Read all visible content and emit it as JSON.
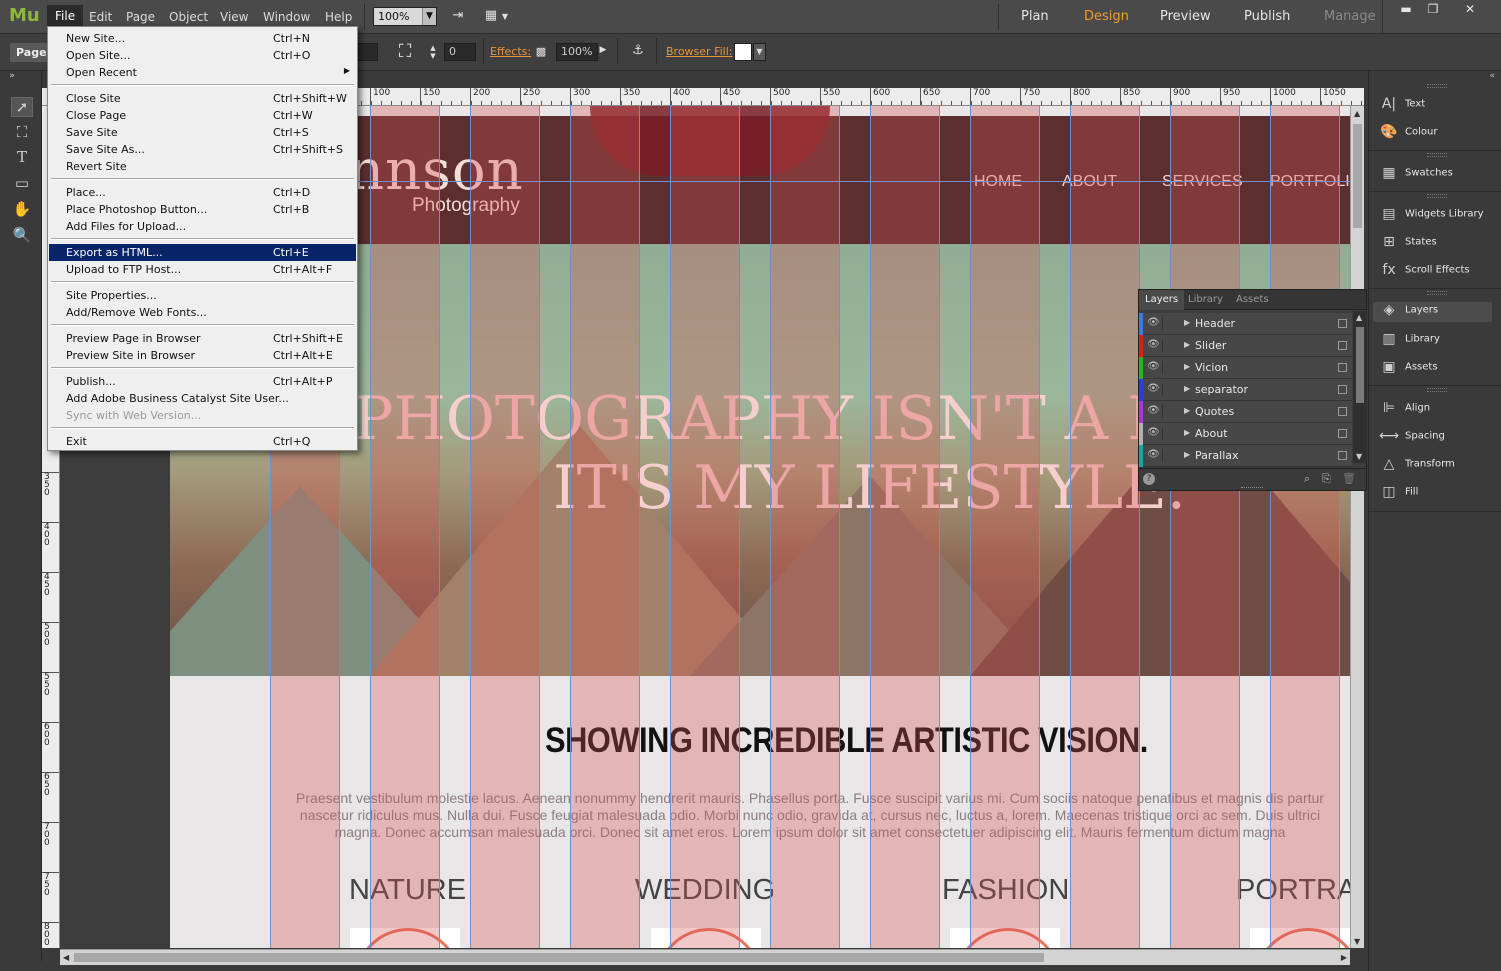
{
  "app": {
    "logo": "Mu"
  },
  "menubar": {
    "items": [
      "File",
      "Edit",
      "Page",
      "Object",
      "View",
      "Window",
      "Help"
    ]
  },
  "toolbar": {
    "zoom_value": "100%"
  },
  "modes": {
    "plan": "Plan",
    "design": "Design",
    "preview": "Preview",
    "publish": "Publish",
    "manage": "Manage"
  },
  "control": {
    "page_label": "Page",
    "rotate_value": "0",
    "effects_label": "Effects:",
    "opacity_value": "100%",
    "browser_fill_label": "Browser Fill:",
    "browser_fill_color": "#ffffff"
  },
  "ruler": {
    "h_labels": [
      "100",
      "150",
      "200",
      "250",
      "300",
      "350",
      "400",
      "450",
      "500",
      "550",
      "600",
      "650",
      "700",
      "750",
      "800",
      "850",
      "900",
      "950",
      "1000",
      "1050"
    ],
    "v_labels": [
      "350",
      "400",
      "450",
      "500",
      "550",
      "600",
      "650",
      "700",
      "750",
      "800"
    ]
  },
  "file_menu": {
    "groups": [
      [
        {
          "label": "New Site...",
          "shortcut": "Ctrl+N"
        },
        {
          "label": "Open Site...",
          "shortcut": "Ctrl+O"
        },
        {
          "label": "Open Recent",
          "shortcut": "",
          "submenu": true
        }
      ],
      [
        {
          "label": "Close Site",
          "shortcut": "Ctrl+Shift+W"
        },
        {
          "label": "Close Page",
          "shortcut": "Ctrl+W"
        },
        {
          "label": "Save Site",
          "shortcut": "Ctrl+S"
        },
        {
          "label": "Save Site As...",
          "shortcut": "Ctrl+Shift+S"
        },
        {
          "label": "Revert Site",
          "shortcut": ""
        }
      ],
      [
        {
          "label": "Place...",
          "shortcut": "Ctrl+D"
        },
        {
          "label": "Place Photoshop Button...",
          "shortcut": "Ctrl+B"
        },
        {
          "label": "Add Files for Upload...",
          "shortcut": ""
        }
      ],
      [
        {
          "label": "Export as HTML...",
          "shortcut": "Ctrl+E",
          "highlighted": true
        },
        {
          "label": "Upload to FTP Host...",
          "shortcut": "Ctrl+Alt+F"
        }
      ],
      [
        {
          "label": "Site Properties...",
          "shortcut": ""
        },
        {
          "label": "Add/Remove Web Fonts...",
          "shortcut": ""
        }
      ],
      [
        {
          "label": "Preview Page in Browser",
          "shortcut": "Ctrl+Shift+E"
        },
        {
          "label": "Preview Site in Browser",
          "shortcut": "Ctrl+Alt+E"
        }
      ],
      [
        {
          "label": "Publish...",
          "shortcut": "Ctrl+Alt+P"
        },
        {
          "label": "Add Adobe Business Catalyst Site User...",
          "shortcut": ""
        },
        {
          "label": "Sync with Web Version...",
          "shortcut": "",
          "disabled": true
        }
      ],
      [
        {
          "label": "Exit",
          "shortcut": "Ctrl+Q"
        }
      ]
    ]
  },
  "site": {
    "brand_main": "nnson",
    "brand_sub": "Photography",
    "nav": [
      "HOME",
      "ABOUT",
      "SERVICES",
      "PORTFOLIO"
    ],
    "hero_line1": "PHOTOGRAPHY ISN'T A H",
    "hero_line2": "IT'S MY LIFESTYLE.",
    "section_title": "SHOWING INCREDIBLE ARTISTIC VISION.",
    "section_body_1": "Praesent vestibulum molestie lacus. Aenean nonummy hendrerit mauris. Phasellus porta. Fusce suscipit varius mi. Cum sociis natoque penatibus et magnis dis partur",
    "section_body_2": "nascetur ridiculus mus. Nulla dui. Fusce feugiat malesuada odio. Morbi nunc odio, gravida at, cursus nec, luctus a, lorem. Maecenas tristique orci ac sem. Duis ultrici",
    "section_body_3": "magna. Donec accumsan malesuada orci. Donec sit amet eros. Lorem ipsum dolor sit amet consectetuer adipiscing elit. Mauris fermentum dictum magna",
    "categories": [
      "NATURE",
      "WEDDING",
      "FASHION",
      "PORTRA"
    ]
  },
  "right_panel": {
    "groups": [
      [
        {
          "label": "Text",
          "icon": "text-icon"
        },
        {
          "label": "Colour",
          "icon": "palette-icon"
        }
      ],
      [
        {
          "label": "Swatches",
          "icon": "swatches-icon"
        }
      ],
      [
        {
          "label": "Widgets Library",
          "icon": "widgets-icon"
        },
        {
          "label": "States",
          "icon": "states-icon"
        },
        {
          "label": "Scroll Effects",
          "icon": "fx-icon"
        }
      ],
      [
        {
          "label": "Layers",
          "icon": "layers-icon",
          "selected": true
        },
        {
          "label": "Library",
          "icon": "library-icon"
        },
        {
          "label": "Assets",
          "icon": "assets-icon"
        }
      ],
      [
        {
          "label": "Align",
          "icon": "align-icon"
        },
        {
          "label": "Spacing",
          "icon": "spacing-icon"
        },
        {
          "label": "Transform",
          "icon": "transform-icon"
        },
        {
          "label": "Fill",
          "icon": "fill-icon"
        }
      ]
    ]
  },
  "layers_panel": {
    "tabs": [
      "Layers",
      "Library",
      "Assets"
    ],
    "rows": [
      {
        "name": "Header",
        "color": "#3f7ad8"
      },
      {
        "name": "Slider",
        "color": "#d02020"
      },
      {
        "name": "Vicion",
        "color": "#2dae2d"
      },
      {
        "name": "separator",
        "color": "#2c3fd2"
      },
      {
        "name": "Quotes",
        "color": "#ad36c9"
      },
      {
        "name": "About",
        "color": "#b0b0b0"
      },
      {
        "name": "Parallax",
        "color": "#1aa39f"
      }
    ]
  }
}
